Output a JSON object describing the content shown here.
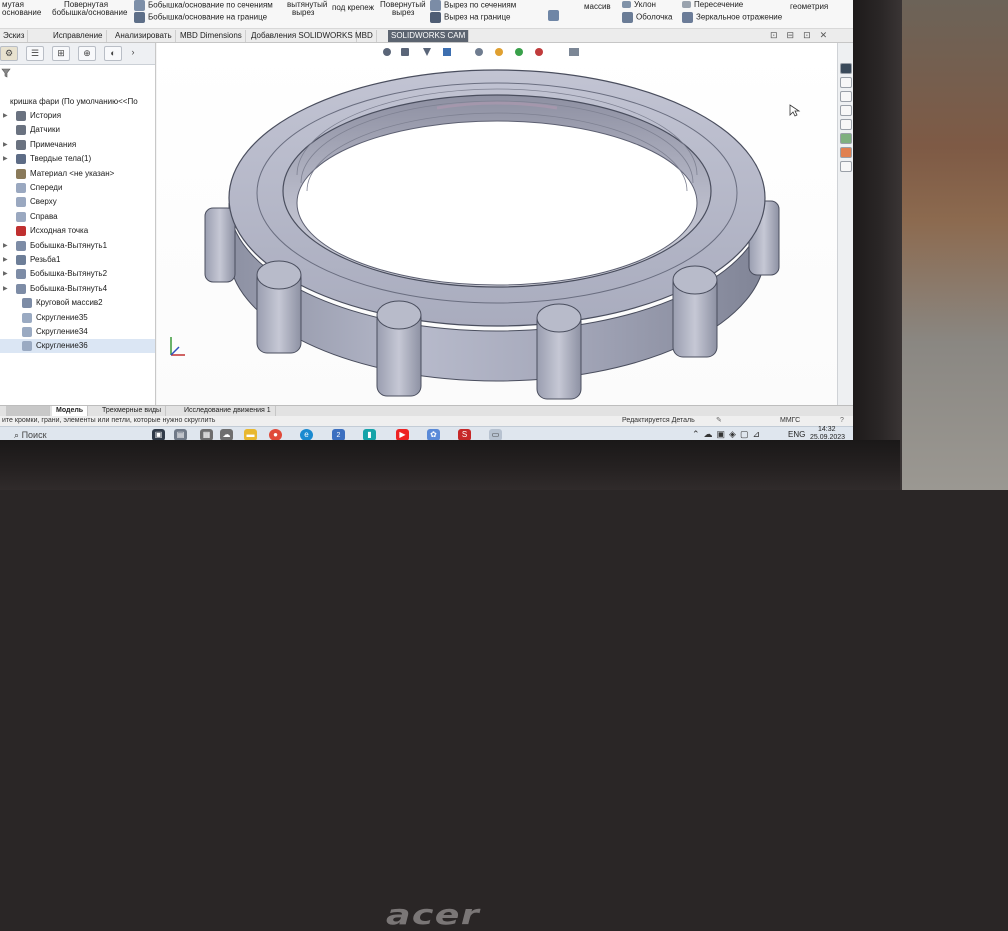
{
  "ribbon": {
    "items": [
      {
        "text": "мутая"
      },
      {
        "text": "основание"
      },
      {
        "text": "Повернутая"
      },
      {
        "text": "бобышка/основание"
      },
      {
        "text": "Бобышка/основание по сечениям"
      },
      {
        "text": "Бобышка/основание на границе"
      },
      {
        "text": "вытянутый"
      },
      {
        "text": "вырез"
      },
      {
        "text": "под крепеж"
      },
      {
        "text": "Повернутый"
      },
      {
        "text": "вырез"
      },
      {
        "text": "Вырез по сечениям"
      },
      {
        "text": "Вырез на границе"
      },
      {
        "text": "массив"
      },
      {
        "text": "Уклон"
      },
      {
        "text": "Оболочка"
      },
      {
        "text": "Пересечение"
      },
      {
        "text": "Зеркальное отражение"
      },
      {
        "text": "геометрия"
      }
    ]
  },
  "tabs": [
    "Эскиз",
    "Исправление",
    "Анализировать",
    "MBD Dimensions",
    "Добавления SOLIDWORKS",
    "MBD",
    "SOLIDWORKS CAM"
  ],
  "tree": {
    "root": "кришка фари  (По умолчанию<<По",
    "items": [
      {
        "label": "История",
        "icon": "history-icon"
      },
      {
        "label": "Датчики",
        "icon": "sensor-icon"
      },
      {
        "label": "Примечания",
        "icon": "annotation-icon"
      },
      {
        "label": "Твердые тела(1)",
        "icon": "solid-bodies-icon"
      },
      {
        "label": "Материал <не указан>",
        "icon": "material-icon"
      },
      {
        "label": "Спереди",
        "icon": "plane-icon"
      },
      {
        "label": "Сверху",
        "icon": "plane-icon"
      },
      {
        "label": "Справа",
        "icon": "plane-icon"
      },
      {
        "label": "Исходная точка",
        "icon": "origin-icon"
      },
      {
        "label": "Бобышка-Вытянуть1",
        "icon": "extrude-icon"
      },
      {
        "label": "Резьба1",
        "icon": "thread-icon"
      },
      {
        "label": "Бобышка-Вытянуть2",
        "icon": "extrude-icon"
      },
      {
        "label": "Бобышка-Вытянуть4",
        "icon": "extrude-icon"
      },
      {
        "label": "Круговой массив2",
        "icon": "pattern-icon"
      },
      {
        "label": "Скругление35",
        "icon": "fillet-icon"
      },
      {
        "label": "Скругление34",
        "icon": "fillet-icon"
      },
      {
        "label": "Скругление36",
        "icon": "fillet-icon"
      }
    ]
  },
  "bottom_tabs": [
    "Модель",
    "Трехмерные виды",
    "Исследование движения 1"
  ],
  "status": {
    "hint": "ите кромки, грани, элементы или петли, которые нужно скруглить",
    "editing": "Редактируется Деталь",
    "units": "ММГС"
  },
  "taskbar": {
    "search_placeholder": "Поиск",
    "lang": "ENG",
    "time": "14:32",
    "date": "25.09.2023",
    "mail_badge": "2"
  },
  "brand": "acer"
}
